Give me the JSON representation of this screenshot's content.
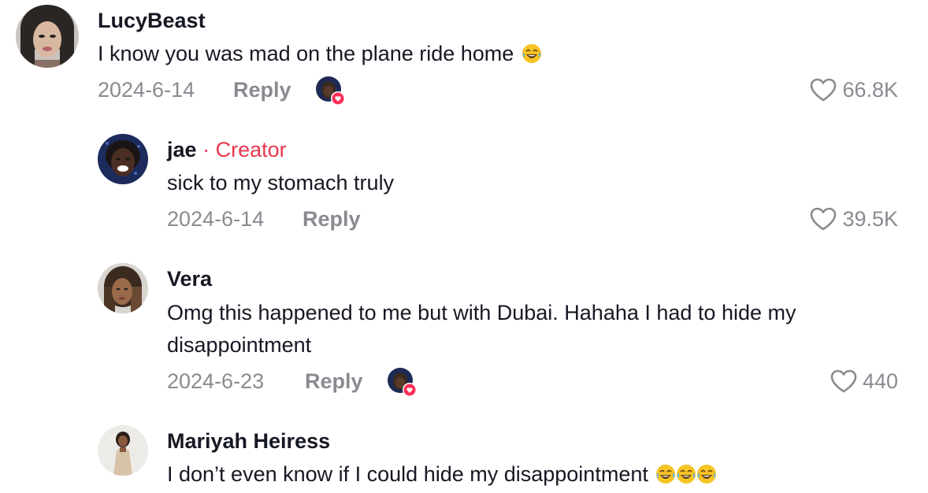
{
  "comments": [
    {
      "username": "LucyBeast",
      "text": "I know you was mad on the plane ride home",
      "emoji": "😂",
      "date": "2024-6-14",
      "reply_label": "Reply",
      "likes": "66.8K",
      "creator_liked": true
    },
    {
      "username": "jae",
      "badge_separator": "·",
      "badge": "Creator",
      "text": "sick to my stomach truly",
      "date": "2024-6-14",
      "reply_label": "Reply",
      "likes": "39.5K",
      "creator_liked": false
    },
    {
      "username": "Vera",
      "text_line1": "Omg this happened to me but with Dubai. Hahaha I had to hide my",
      "text_line2": "disappointment",
      "date": "2024-6-23",
      "reply_label": "Reply",
      "likes": "440",
      "creator_liked": true
    },
    {
      "username": "Mariyah Heiress",
      "text": "I don’t even know if I could hide my disappointment",
      "emojis": [
        "😂",
        "😂",
        "😂"
      ]
    }
  ],
  "colors": {
    "text": "#161823",
    "secondary": "#8a8b91",
    "creator": "#e8364f",
    "like_badge": "#fe2c55"
  },
  "icons": {
    "like": "heart-outline-icon",
    "liked_by_creator": "creator-liked-heart-icon",
    "emoji": "face-with-tears-of-joy-emoji"
  }
}
